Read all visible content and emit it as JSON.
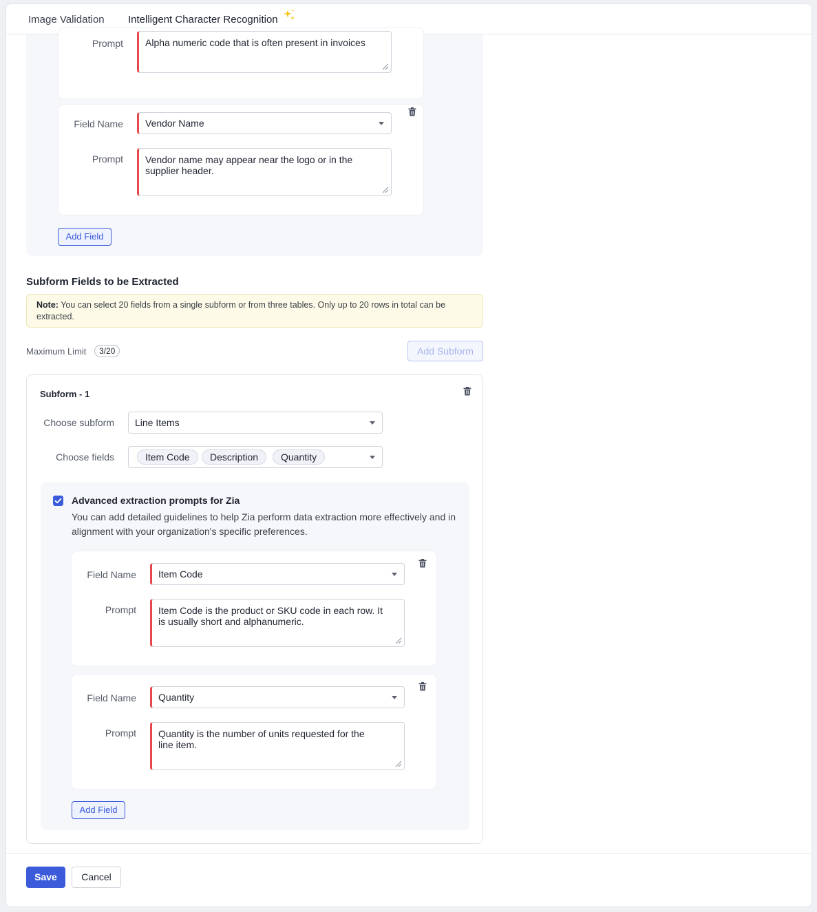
{
  "tabs": {
    "image_validation": "Image Validation",
    "icr": "Intelligent Character Recognition"
  },
  "top_fields": {
    "partial_prompt_label": "Prompt",
    "partial_prompt_value": "Alpha numeric code that is often present in invoices",
    "field_name_label": "Field Name",
    "field_name_value": "Vendor Name",
    "prompt_label": "Prompt",
    "prompt_value": "Vendor name may appear near the logo or in the supplier header.",
    "add_field": "Add Field"
  },
  "subform_section": {
    "title": "Subform Fields to be Extracted",
    "note_bold": "Note:",
    "note_text": " You can select 20 fields from a single subform or from three tables. Only up to 20 rows in total can be extracted.",
    "max_limit_label": "Maximum Limit",
    "max_limit_value": "3/20",
    "add_subform": "Add Subform"
  },
  "subform1": {
    "title": "Subform - 1",
    "choose_subform_label": "Choose subform",
    "choose_subform_value": "Line Items",
    "choose_fields_label": "Choose fields",
    "chips": [
      "Item Code",
      "Description",
      "Quantity"
    ],
    "advanced": {
      "checked": true,
      "title": "Advanced extraction prompts for Zia",
      "description": "You can add detailed guidelines to help Zia perform data extraction more effectively and in alignment with your organization's specific preferences.",
      "fields": [
        {
          "field_name_label": "Field Name",
          "field_name_value": "Item Code",
          "prompt_label": "Prompt",
          "prompt_value": "Item Code is the product or SKU code in each row. It is usually short and alphanumeric."
        },
        {
          "field_name_label": "Field Name",
          "field_name_value": "Quantity",
          "prompt_label": "Prompt",
          "prompt_value": "Quantity is the number of units requested for the line item."
        }
      ],
      "add_field": "Add Field"
    }
  },
  "footer": {
    "save": "Save",
    "cancel": "Cancel"
  },
  "colors": {
    "accent": "#3b5bdb",
    "required_marker": "#e5484d",
    "note_bg": "#fdfbe7",
    "sparkle": "#f5c518"
  }
}
